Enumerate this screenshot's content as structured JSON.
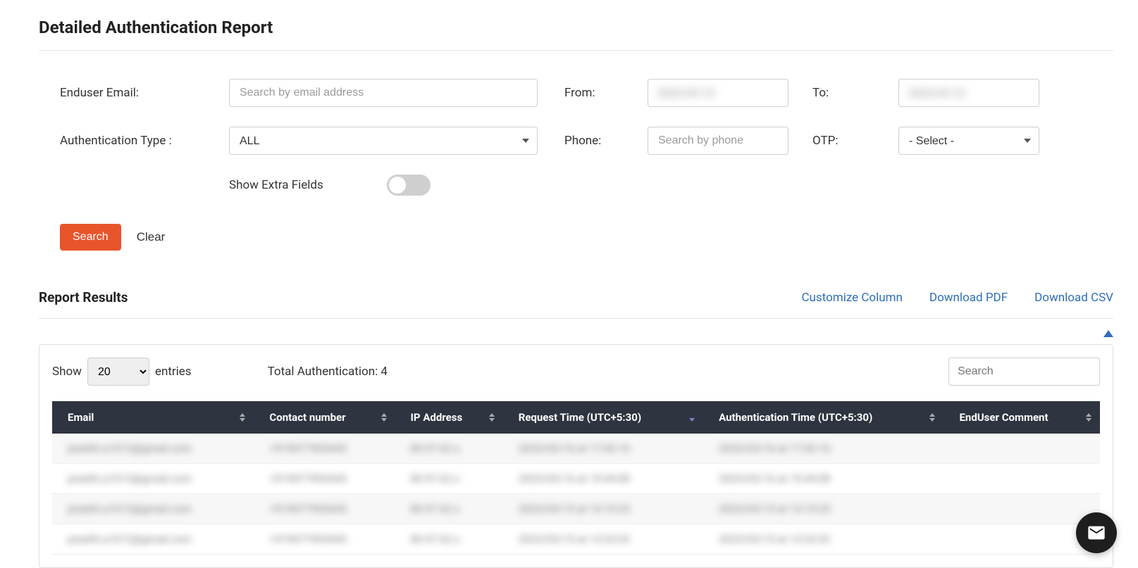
{
  "page": {
    "title": "Detailed Authentication Report"
  },
  "filters": {
    "enduser_email_label": "Enduser Email:",
    "enduser_email_placeholder": "Search by email address",
    "from_label": "From:",
    "from_value": "2023-03-15",
    "to_label": "To:",
    "to_value": "2023-03-16",
    "auth_type_label": "Authentication Type :",
    "auth_type_value": "ALL",
    "phone_label": "Phone:",
    "phone_placeholder": "Search by phone",
    "otp_label": "OTP:",
    "otp_value": "- Select -",
    "show_extra_label": "Show Extra Fields"
  },
  "actions": {
    "search": "Search",
    "clear": "Clear"
  },
  "results": {
    "title": "Report Results",
    "customize_column": "Customize Column",
    "download_pdf": "Download PDF",
    "download_csv": "Download CSV",
    "show_label": "Show",
    "entries_label": "entries",
    "entries_value": "20",
    "total_auth_label": "Total Authentication: 4",
    "search_placeholder": "Search",
    "columns": [
      "Email",
      "Contact number",
      "IP Address",
      "Request Time (UTC+5:30)",
      "Authentication Time (UTC+5:30)",
      "EndUser Comment"
    ],
    "rows": [
      {
        "email": "preethi.a1012@gmail.com",
        "contact": "+919077903443",
        "ip": "80.97.62.x",
        "request_time": "2023/03/16 at 17:03:16",
        "auth_time": "2023/03/16 at 17:03:16",
        "comment": ""
      },
      {
        "email": "preethi.a1012@gmail.com",
        "contact": "+919077903443",
        "ip": "80.97.62.x",
        "request_time": "2023/03/16 at 15:44:08",
        "auth_time": "2023/03/16 at 15:44:08",
        "comment": ""
      },
      {
        "email": "preethi.a1012@gmail.com",
        "contact": "+919077903443",
        "ip": "80.97.62.x",
        "request_time": "2023/03/15 at 14:19:25",
        "auth_time": "2023/03/15 at 14:19:25",
        "comment": ""
      },
      {
        "email": "preethi.a1012@gmail.com",
        "contact": "+919077903443",
        "ip": "80.97.62.x",
        "request_time": "2023/03/15 at 13:32:02",
        "auth_time": "2023/03/15 at 13:32:02",
        "comment": ""
      }
    ]
  }
}
